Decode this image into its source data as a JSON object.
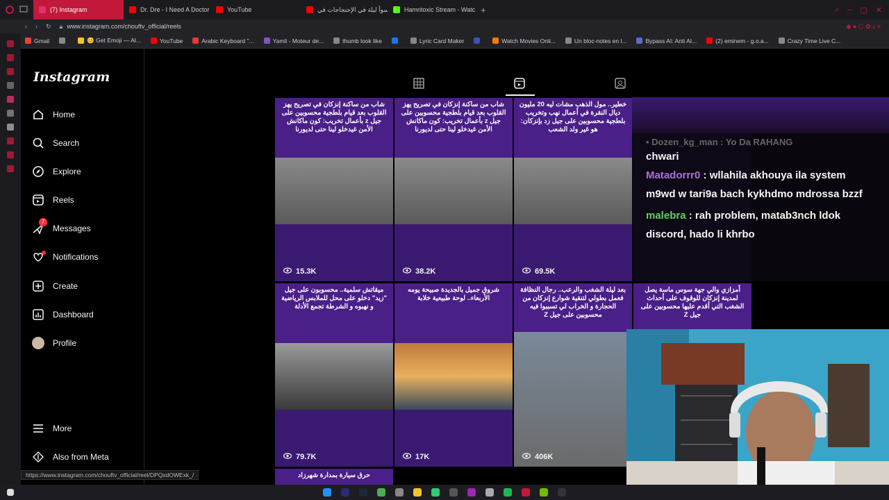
{
  "browser": {
    "tabs": [
      {
        "label": "(7) Instagram",
        "active": true,
        "color": "#e1306c"
      },
      {
        "label": "Dr. Dre - I Need A Doctor",
        "active": false,
        "color": "#ff0000"
      },
      {
        "label": "YouTube",
        "active": false,
        "color": "#ff0000"
      },
      {
        "label": "أسوأ ليلة في الإحتجاجات في",
        "active": false,
        "color": "#ff0000"
      },
      {
        "label": "Hamritoxic Stream - Watc",
        "active": false,
        "color": "#53fc18"
      }
    ],
    "url": "www.instagram.com/chouftv_official/reels",
    "bookmarks": [
      {
        "label": "Gmail",
        "color": "#ea4335"
      },
      {
        "label": "",
        "color": "#888"
      },
      {
        "label": "😊 Get Emoji — Al...",
        "color": "#f5c518"
      },
      {
        "label": "YouTube",
        "color": "#ff0000"
      },
      {
        "label": "Arabic Keyboard \"...",
        "color": "#e53935"
      },
      {
        "label": "Yamli - Moteur de...",
        "color": "#7e57c2"
      },
      {
        "label": "thumb look like",
        "color": "#888"
      },
      {
        "label": "",
        "color": "#1877f2"
      },
      {
        "label": "Lyric Card Maker",
        "color": "#888"
      },
      {
        "label": "",
        "color": "#3f51b5"
      },
      {
        "label": "Watch Movies Onli...",
        "color": "#f57c00"
      },
      {
        "label": "Un bloc-notes en l...",
        "color": "#888"
      },
      {
        "label": "Bypass AI: Anti AI...",
        "color": "#5c6bc0"
      },
      {
        "label": "(2) eminem - g.o.a...",
        "color": "#ff0000"
      },
      {
        "label": "Crazy Time Live C...",
        "color": "#888"
      }
    ]
  },
  "instagram": {
    "logo": "Instagram",
    "nav": [
      {
        "label": "Home",
        "icon": "home-icon"
      },
      {
        "label": "Search",
        "icon": "search-icon"
      },
      {
        "label": "Explore",
        "icon": "compass-icon"
      },
      {
        "label": "Reels",
        "icon": "reels-icon"
      },
      {
        "label": "Messages",
        "icon": "messages-icon",
        "badge": "7"
      },
      {
        "label": "Notifications",
        "icon": "heart-icon"
      },
      {
        "label": "Create",
        "icon": "plus-icon"
      },
      {
        "label": "Dashboard",
        "icon": "dashboard-icon"
      },
      {
        "label": "Profile",
        "icon": "avatar"
      }
    ],
    "more": "More",
    "also_from_meta": "Also from Meta",
    "reels": [
      {
        "headline": "شاب من ساكنة إنزكان في تصريح يهز القلوب بعد قيام بلطجية محسوبين على جيل z بأعمال تخريب: كون ماكانش الأمن غيدخلو لينا حتى لديورنا",
        "views": "15.3K"
      },
      {
        "headline": "شاب من ساكنة إنزكان في تصريح يهز القلوب بعد قيام بلطجية محسوبين على جيل z بأعمال تخريب: كون ماكانش الأمن غيدخلو لينا حتى لديورنا",
        "views": "38.2K"
      },
      {
        "headline": "خطير.. مول الذهب مشات ليه 20 مليون ديال النقرة في أعمال نهب وتخريب بلطجية محسوبين على جيل زد بإنزكان: هو غير ولد الشعب",
        "views": "69.5K"
      },
      {
        "headline": "",
        "views": ""
      },
      {
        "headline": "ميقاتش سلمية.. محسوبون على جيل \"زيد\" دخلو على محل للملابس الرياضية و نهبوه و الشرطة تجمع الأدلة",
        "views": "79.7K"
      },
      {
        "headline": "شروق جميل بالجديدة صبيحة يومه الأربعاء.. لوحة طبيعية خلابة",
        "views": "17K"
      },
      {
        "headline": "بعد ليلة الشغب والرعب.. رجال النظافة فعمل بطولي لتنقية شوارع إنزكان من الحجارة و الخراب لي تسببوا فيه محسوبين على جيل Z",
        "views": "406K"
      },
      {
        "headline": "أمزازي والي جهة سوس ماسة يصل لمدينة إنزكان للوقوف على أحداث الشغب التي أقدم عليها محسوبين على جيل Z",
        "views": ""
      }
    ],
    "next_row_headline": "حرق سيارة بمدارة شهرزاد"
  },
  "stream_chat": {
    "faded_line": "• Dozen_kg_man : Yo Da RAHANG",
    "lines": [
      {
        "user": "",
        "text": "chwari"
      },
      {
        "user": "Matadorrr0",
        "text": " : wllahila akhouya ila system m9wd w tari9a bach kykhdmo mdrossa bzzf"
      },
      {
        "user": "malebra",
        "text": " : rah problem, matab3nch ldok discord, hado li khrbo"
      }
    ]
  },
  "status_url": "https://www.instagram.com/chouftv_official/reel/DPQxdOWExk_/",
  "colors": {
    "accent": "#c2193a",
    "ig_bg": "#000000",
    "reel_purple": "#4a1f88"
  }
}
